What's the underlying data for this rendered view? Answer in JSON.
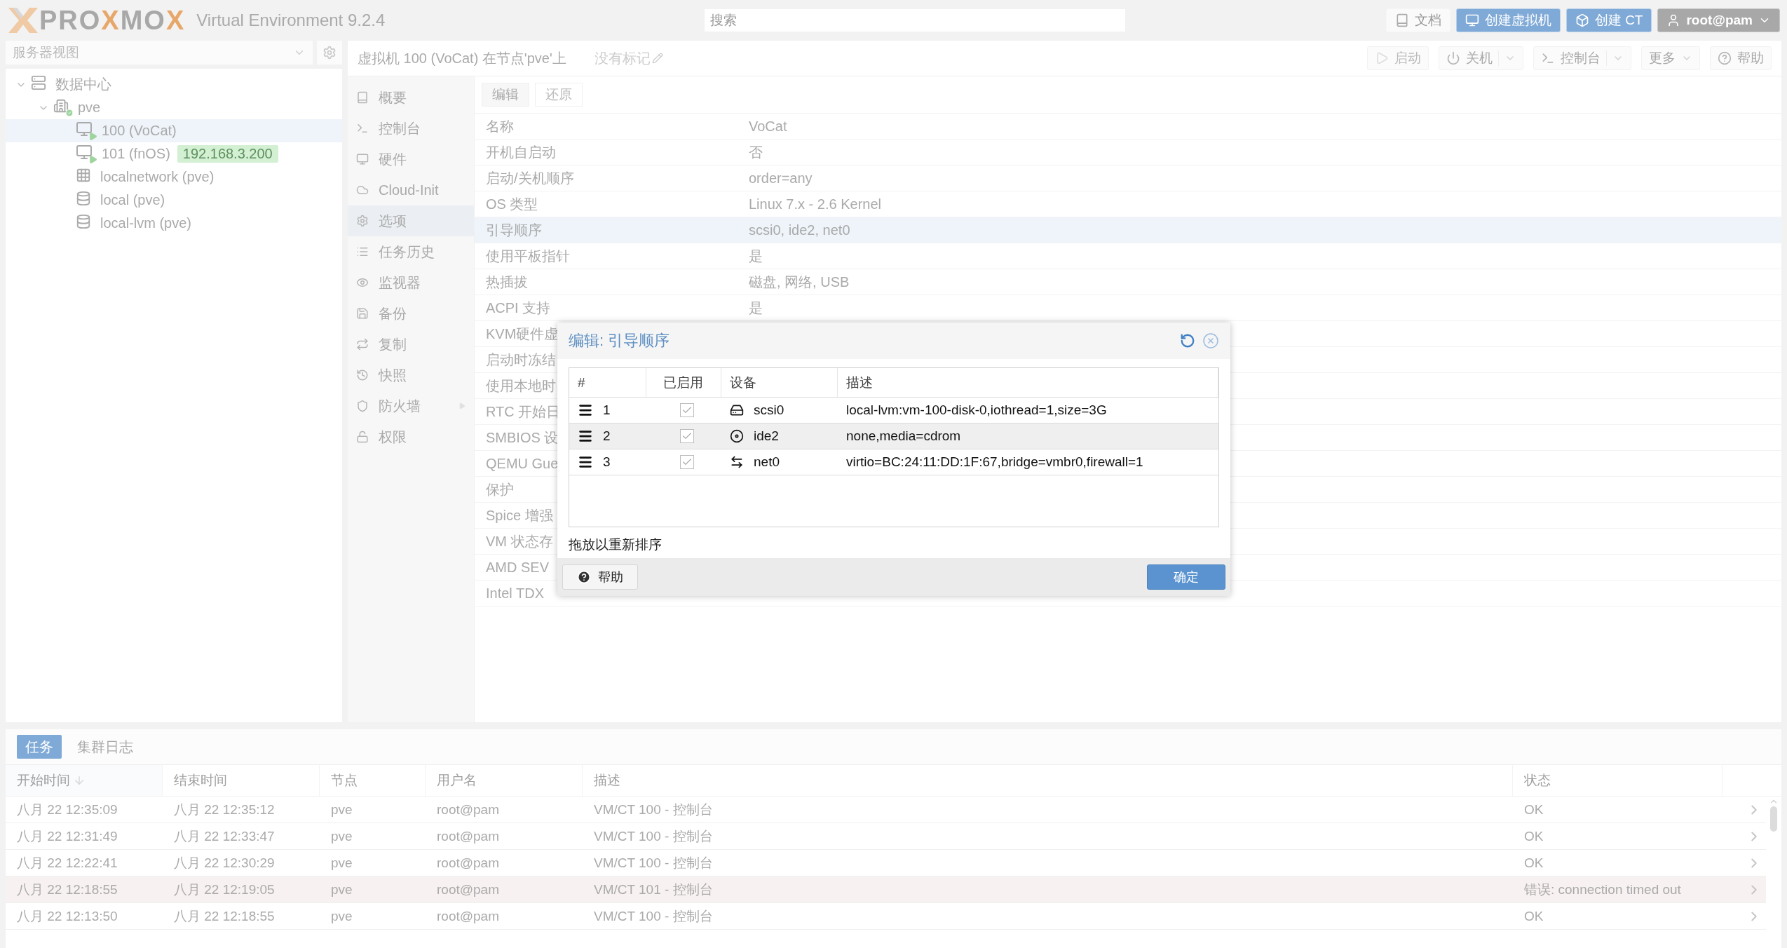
{
  "header": {
    "logo": [
      {
        "text": "PRO",
        "accent": false
      },
      {
        "text": "X",
        "accent": true
      },
      {
        "text": "MO",
        "accent": false
      },
      {
        "text": "X",
        "accent": true
      }
    ],
    "product": "Virtual Environment 9.2.4",
    "search": {
      "placeholder": "搜索"
    },
    "buttons": [
      {
        "label": "文档",
        "kind": "docs"
      },
      {
        "label": "创建虚拟机",
        "kind": "vm"
      },
      {
        "label": "创建 CT",
        "kind": "ct"
      },
      {
        "label": "root@pam",
        "kind": "user"
      }
    ]
  },
  "sidebar": {
    "view_select": "服务器视图",
    "tree": [
      {
        "label": "数据中心",
        "kind": "datacenter",
        "expanded": true,
        "selected": false,
        "children": [
          {
            "label": "pve",
            "kind": "node",
            "expanded": true,
            "selected": false,
            "children": [
              {
                "label": "100 (VoCat)",
                "kind": "vm",
                "selected": true
              },
              {
                "label": "101 (fnOS)",
                "kind": "vm",
                "tag": "192.168.3.200",
                "selected": false
              },
              {
                "label": "localnetwork (pve)",
                "kind": "network",
                "selected": false
              },
              {
                "label": "local (pve)",
                "kind": "storage",
                "selected": false
              },
              {
                "label": "local-lvm (pve)",
                "kind": "storage",
                "selected": false
              }
            ]
          }
        ]
      }
    ]
  },
  "main": {
    "title": "虚拟机 100 (VoCat) 在节点'pve'上",
    "tags": "没有标记",
    "toolbar": [
      {
        "label": "启动",
        "kind": "start",
        "disabled": true
      },
      {
        "label": "关机",
        "kind": "shutdown",
        "disabled": false
      },
      {
        "label": "控制台",
        "kind": "console",
        "disabled": false
      },
      {
        "label": "更多",
        "kind": "more",
        "disabled": false
      },
      {
        "label": "帮助",
        "kind": "help",
        "disabled": false
      }
    ],
    "nav": [
      {
        "label": "概要",
        "kind": "summary",
        "selected": false,
        "expandable": false
      },
      {
        "label": "控制台",
        "kind": "console",
        "selected": false,
        "expandable": false
      },
      {
        "label": "硬件",
        "kind": "hardware",
        "selected": false,
        "expandable": false
      },
      {
        "label": "Cloud-Init",
        "kind": "cloud",
        "selected": false,
        "expandable": false
      },
      {
        "label": "选项",
        "kind": "options",
        "selected": true,
        "expandable": false
      },
      {
        "label": "任务历史",
        "kind": "tasks",
        "selected": false,
        "expandable": false
      },
      {
        "label": "监视器",
        "kind": "monitor",
        "selected": false,
        "expandable": false
      },
      {
        "label": "备份",
        "kind": "backup",
        "selected": false,
        "expandable": false
      },
      {
        "label": "复制",
        "kind": "replication",
        "selected": false,
        "expandable": false
      },
      {
        "label": "快照",
        "kind": "snapshots",
        "selected": false,
        "expandable": false
      },
      {
        "label": "防火墙",
        "kind": "firewall",
        "selected": false,
        "expandable": true
      },
      {
        "label": "权限",
        "kind": "permissions",
        "selected": false,
        "expandable": false
      }
    ],
    "edit_buttons": [
      {
        "label": "编辑",
        "disabled": false
      },
      {
        "label": "还原",
        "disabled": true
      }
    ],
    "options": [
      {
        "name": "名称",
        "value": "VoCat",
        "selected": false
      },
      {
        "name": "开机自启动",
        "value": "否",
        "selected": false
      },
      {
        "name": "启动/关机顺序",
        "value": "order=any",
        "selected": false
      },
      {
        "name": "OS 类型",
        "value": "Linux 7.x - 2.6 Kernel",
        "selected": false
      },
      {
        "name": "引导顺序",
        "value": "scsi0, ide2, net0",
        "selected": true
      },
      {
        "name": "使用平板指针",
        "value": "是",
        "selected": false
      },
      {
        "name": "热插拔",
        "value": "磁盘, 网络, USB",
        "selected": false
      },
      {
        "name": "ACPI 支持",
        "value": "是",
        "selected": false
      },
      {
        "name": "KVM硬件虚",
        "selected": false
      },
      {
        "name": "启动时冻结",
        "selected": false
      },
      {
        "name": "使用本地时",
        "selected": false
      },
      {
        "name": "RTC 开始日",
        "selected": false
      },
      {
        "name": "SMBIOS 设",
        "selected": false
      },
      {
        "name": "QEMU Gue",
        "selected": false
      },
      {
        "name": "保护",
        "selected": false
      },
      {
        "name": "Spice 增强",
        "selected": false
      },
      {
        "name": "VM 状态存",
        "selected": false
      },
      {
        "name": "AMD SEV",
        "selected": false
      },
      {
        "name": "Intel TDX",
        "selected": false
      }
    ]
  },
  "dialog": {
    "title": "编辑: 引导顺序",
    "columns": [
      "#",
      "已启用",
      "设备",
      "描述"
    ],
    "rows": [
      {
        "order": "1",
        "enabled": true,
        "kind": "disk",
        "device": "scsi0",
        "description": "local-lvm:vm-100-disk-0,iothread=1,size=3G",
        "selected": false
      },
      {
        "order": "2",
        "enabled": true,
        "kind": "cdrom",
        "device": "ide2",
        "description": "none,media=cdrom",
        "selected": true
      },
      {
        "order": "3",
        "enabled": true,
        "kind": "net",
        "device": "net0",
        "description": "virtio=BC:24:11:DD:1F:67,bridge=vmbr0,firewall=1",
        "selected": false
      }
    ],
    "hint": "拖放以重新排序",
    "help_button": "帮助",
    "ok_button": "确定"
  },
  "tasks": {
    "tabs": [
      {
        "label": "任务",
        "selected": true
      },
      {
        "label": "集群日志",
        "selected": false
      }
    ],
    "columns": [
      {
        "label": "开始时间",
        "sorted": true
      },
      {
        "label": "结束时间",
        "sorted": false
      },
      {
        "label": "节点",
        "sorted": false
      },
      {
        "label": "用户名",
        "sorted": false
      },
      {
        "label": "描述",
        "sorted": false
      },
      {
        "label": "状态",
        "sorted": false
      }
    ],
    "rows": [
      {
        "start": "八月 22 12:35:09",
        "end": "八月 22 12:35:12",
        "node": "pve",
        "user": "root@pam",
        "description": "VM/CT 100 - 控制台",
        "status": "OK",
        "error": false
      },
      {
        "start": "八月 22 12:31:49",
        "end": "八月 22 12:33:47",
        "node": "pve",
        "user": "root@pam",
        "description": "VM/CT 100 - 控制台",
        "status": "OK",
        "error": false
      },
      {
        "start": "八月 22 12:22:41",
        "end": "八月 22 12:30:29",
        "node": "pve",
        "user": "root@pam",
        "description": "VM/CT 100 - 控制台",
        "status": "OK",
        "error": false
      },
      {
        "start": "八月 22 12:18:55",
        "end": "八月 22 12:19:05",
        "node": "pve",
        "user": "root@pam",
        "description": "VM/CT 101 - 控制台",
        "status": "错误: connection timed out",
        "error": true
      },
      {
        "start": "八月 22 12:13:50",
        "end": "八月 22 12:18:55",
        "node": "pve",
        "user": "root@pam",
        "description": "VM/CT 100 - 控制台",
        "status": "OK",
        "error": false
      }
    ]
  }
}
